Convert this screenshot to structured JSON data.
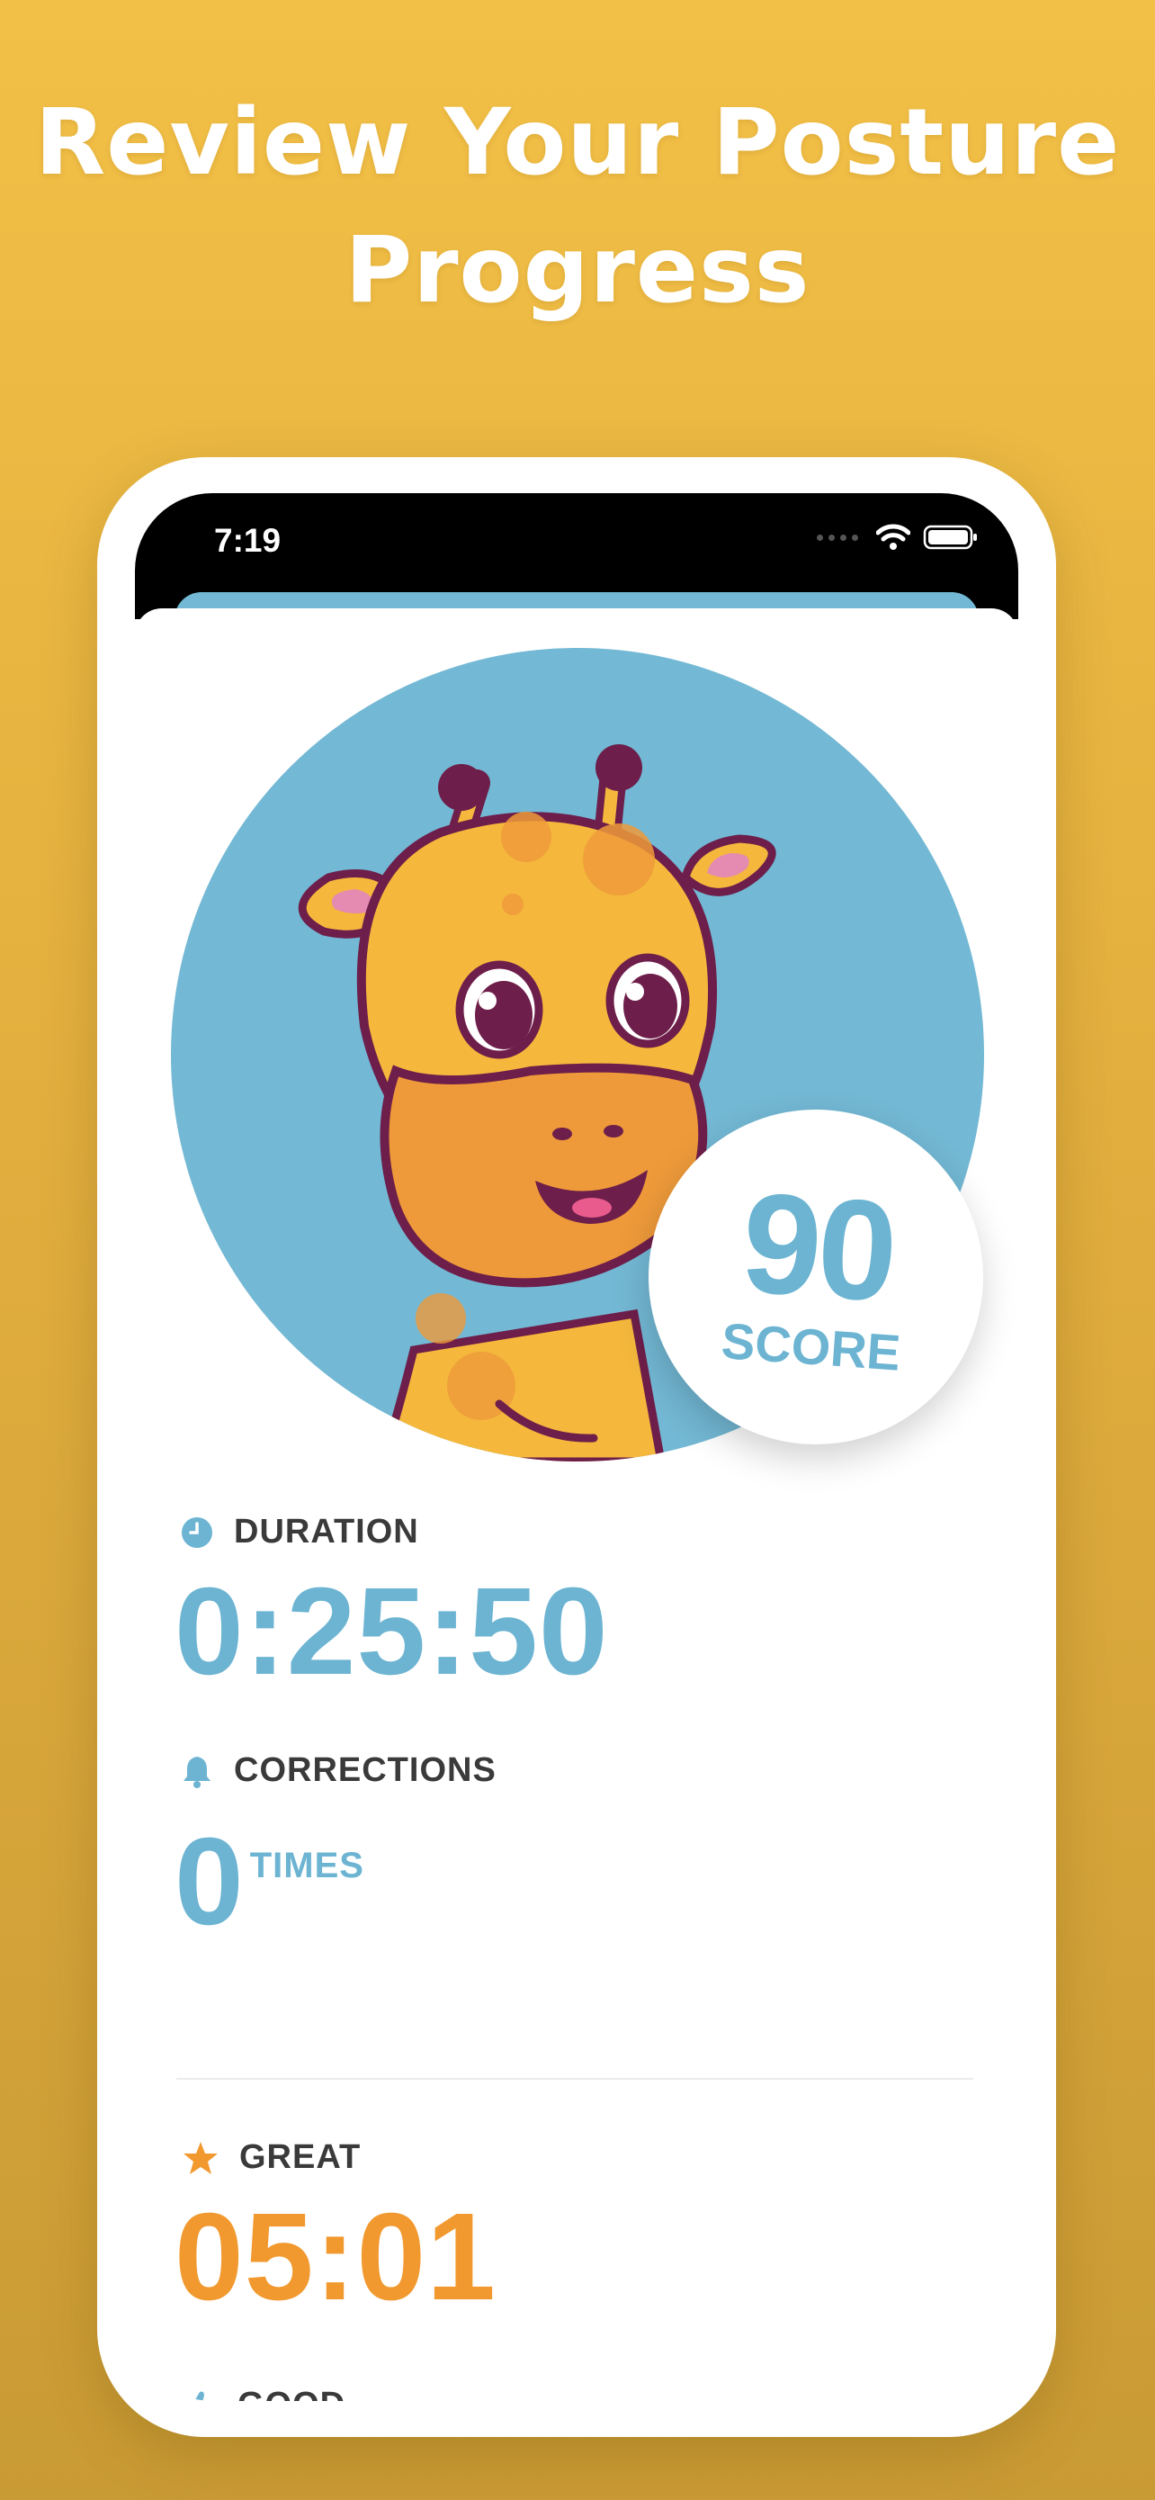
{
  "headline": {
    "line1": "Review Your Posture",
    "line2": "Progress"
  },
  "status_bar": {
    "time": "7:19"
  },
  "score": {
    "value": "90",
    "label": "SCORE"
  },
  "metrics": {
    "duration": {
      "label": "DURATION",
      "value": "0:25:50",
      "icon": "clock-icon"
    },
    "corrections": {
      "label": "CORRECTIONS",
      "value": "0",
      "unit": "TIMES",
      "icon": "bell-icon"
    },
    "great": {
      "label": "GREAT",
      "value": "05:01",
      "icon": "star-icon"
    },
    "good": {
      "label": "GOOD",
      "icon": "thumbs-up-icon"
    }
  },
  "colors": {
    "background_top": "#F2C046",
    "background_bottom": "#C99B35",
    "accent_blue": "#6CB4D2",
    "accent_orange": "#F1992F"
  }
}
